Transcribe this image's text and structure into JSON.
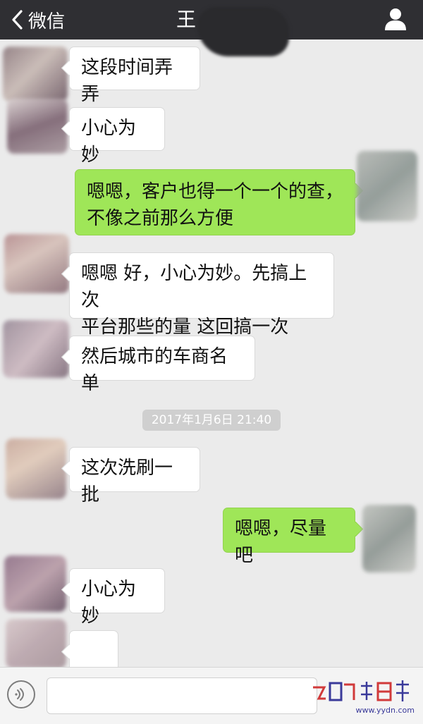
{
  "header": {
    "back_label": "微信",
    "title": "王"
  },
  "messages": [
    {
      "side": "in",
      "text": "这段时间弄弄"
    },
    {
      "side": "in",
      "text": "小心为妙"
    },
    {
      "side": "out",
      "text": "嗯嗯，客户也得一个一个的查，\n不像之前那么方便"
    },
    {
      "side": "in",
      "text": "嗯嗯 好，小心为妙。先搞上次\n平台那些的量 这回搞一次"
    },
    {
      "side": "in",
      "text": "然后城市的车商名单"
    },
    {
      "side": "in",
      "text": "这次洗刷一批"
    },
    {
      "side": "out",
      "text": "嗯嗯，尽量吧"
    },
    {
      "side": "in",
      "text": "小心为妙"
    },
    {
      "side": "in",
      "sticker": "smiley-sticker-icon"
    }
  ],
  "timestamp": "2017年1月6日 21:40",
  "input_bar": {
    "voice_icon": "voice-icon",
    "text_value": ""
  },
  "watermark": {
    "url": "www.yydn.com"
  },
  "colors": {
    "nav_bg": "#2f2f33",
    "chat_bg": "#ebebeb",
    "outgoing_bubble": "#9fe658",
    "incoming_bubble": "#ffffff",
    "timestamp_bg": "#cfcfcf"
  }
}
